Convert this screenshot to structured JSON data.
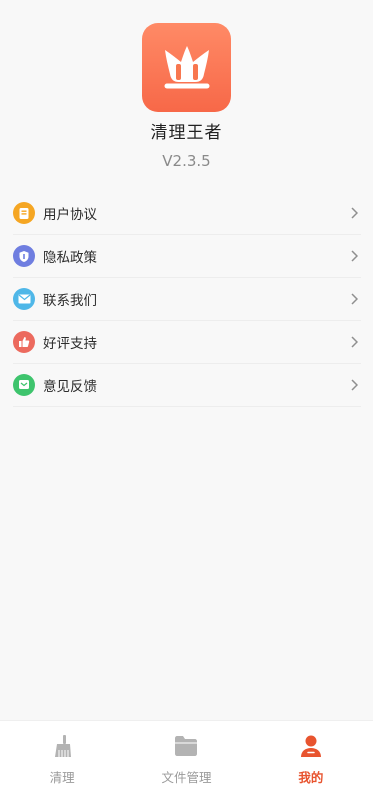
{
  "app": {
    "name": "清理王者",
    "version": "V2.3.5"
  },
  "menu": [
    {
      "label": "用户协议",
      "icon": "document-icon",
      "color": "#f5a623"
    },
    {
      "label": "隐私政策",
      "icon": "shield-icon",
      "color": "#6f7ee0"
    },
    {
      "label": "联系我们",
      "icon": "mail-icon",
      "color": "#4fb7e8"
    },
    {
      "label": "好评支持",
      "icon": "thumbs-up-icon",
      "color": "#ec6a5e"
    },
    {
      "label": "意见反馈",
      "icon": "feedback-icon",
      "color": "#3ec46d"
    }
  ],
  "tabs": [
    {
      "label": "清理",
      "icon": "broom-icon",
      "active": false
    },
    {
      "label": "文件管理",
      "icon": "folder-icon",
      "active": false
    },
    {
      "label": "我的",
      "icon": "user-icon",
      "active": true
    }
  ],
  "colors": {
    "accent": "#e8542f",
    "logo_gradient_top": "#ff8a66",
    "logo_gradient_bottom": "#f76848",
    "background": "#f8f8f8"
  }
}
